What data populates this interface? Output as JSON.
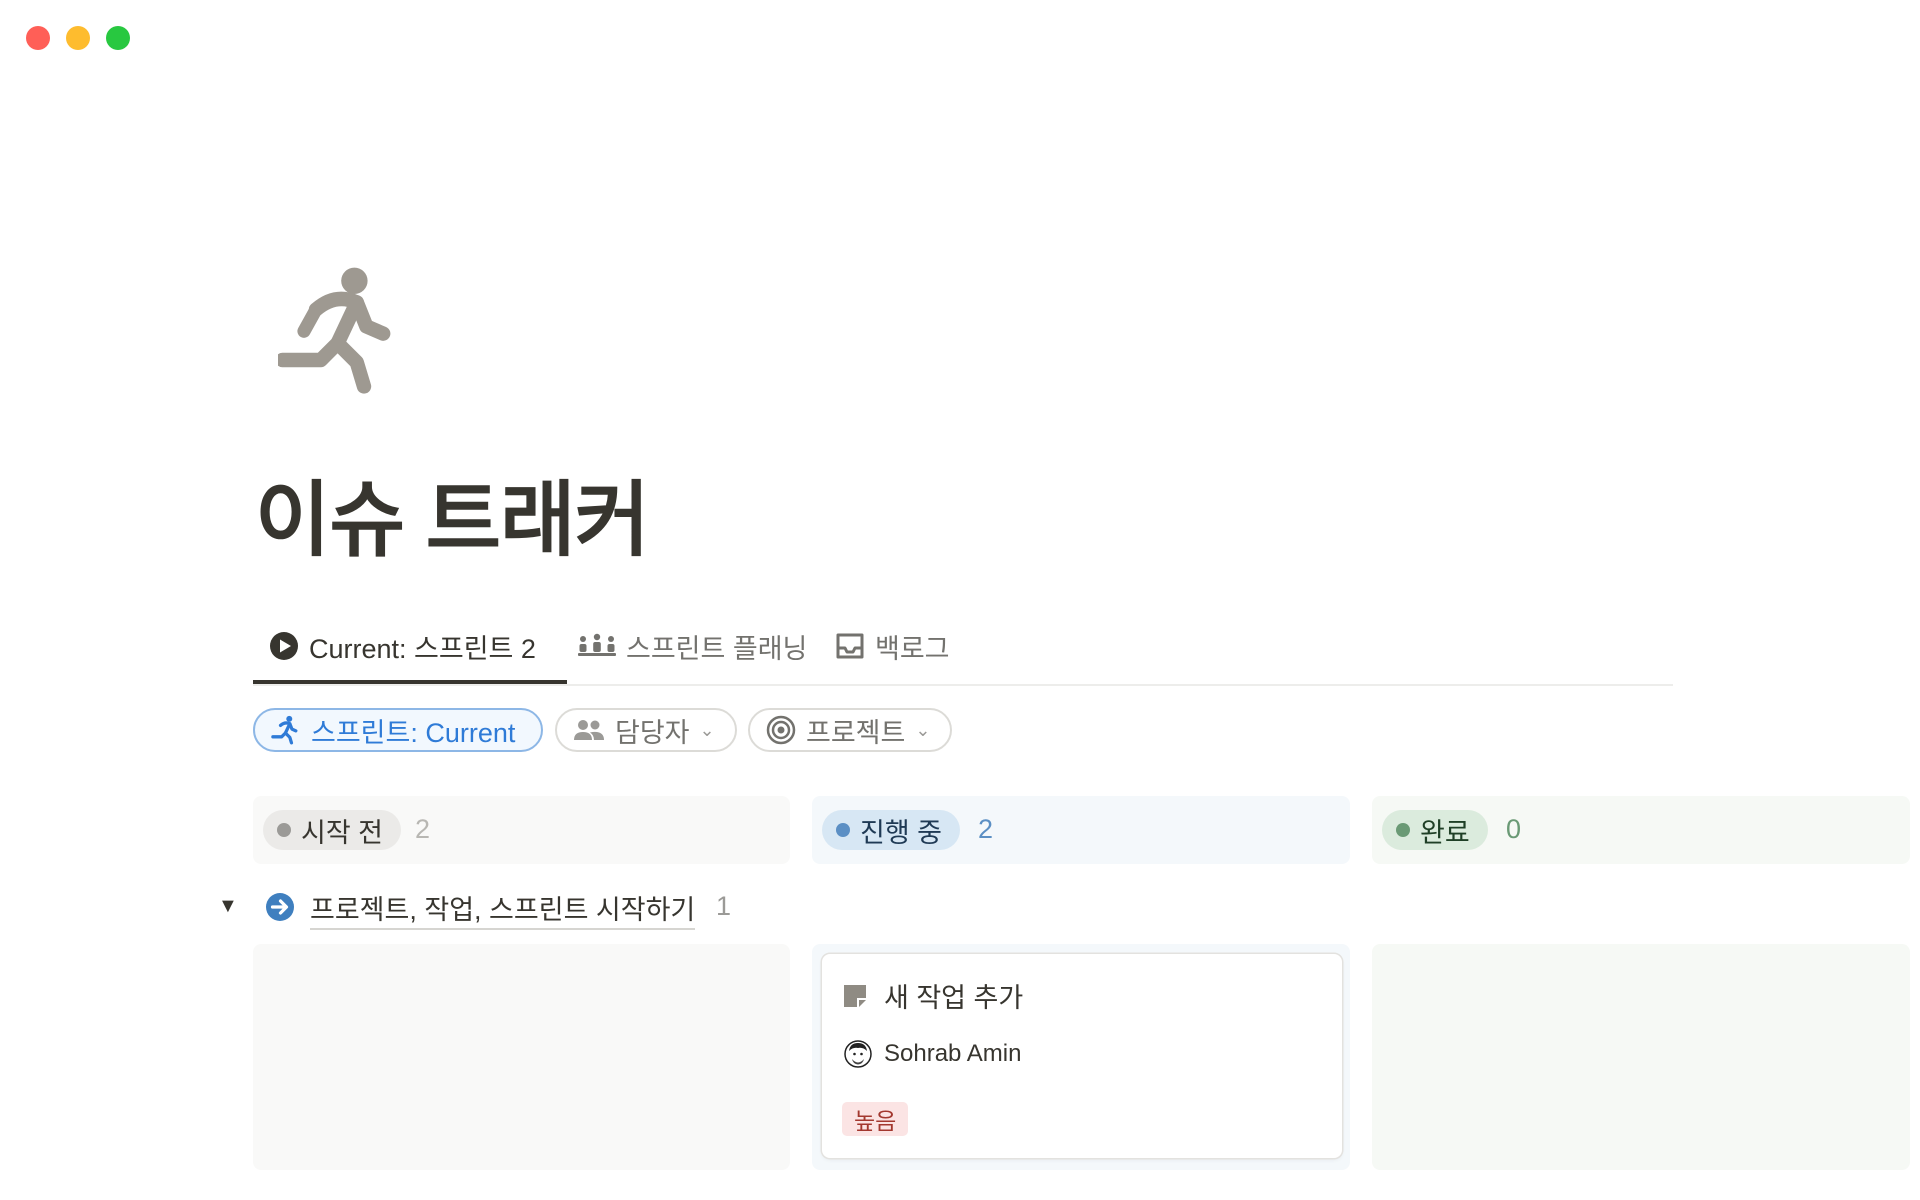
{
  "window": {
    "controls": [
      "close",
      "minimize",
      "zoom"
    ]
  },
  "page": {
    "icon": "running-person-icon",
    "title": "이슈 트래커"
  },
  "tabs": [
    {
      "label": "Current: 스프린트 2",
      "icon": "play-circle-icon",
      "active": true
    },
    {
      "label": "스프린트 플래닝",
      "icon": "people-row-icon",
      "active": false
    },
    {
      "label": "백로그",
      "icon": "inbox-tray-icon",
      "active": false
    }
  ],
  "filters": [
    {
      "label": "스프린트: Current",
      "icon": "running-person-icon",
      "active": true
    },
    {
      "label": "담당자",
      "icon": "people-icon",
      "active": false
    },
    {
      "label": "프로젝트",
      "icon": "target-icon",
      "active": false
    }
  ],
  "columns": [
    {
      "status": "시작 전",
      "count": "2"
    },
    {
      "status": "진행 중",
      "count": "2"
    },
    {
      "status": "완료",
      "count": "0"
    }
  ],
  "group": {
    "name": "프로젝트, 작업, 스프린트 시작하기",
    "count": "1",
    "toggle": "▼",
    "icon": "arrow-right-circle-icon"
  },
  "card": {
    "title": "새 작업 추가",
    "icon": "page-icon",
    "assignee": "Sohrab Amin",
    "priority": "높음"
  },
  "colors": {
    "accent_blue": "#2f7bd7",
    "priority_bg": "#fbe4e4",
    "priority_text": "#a3382f"
  }
}
